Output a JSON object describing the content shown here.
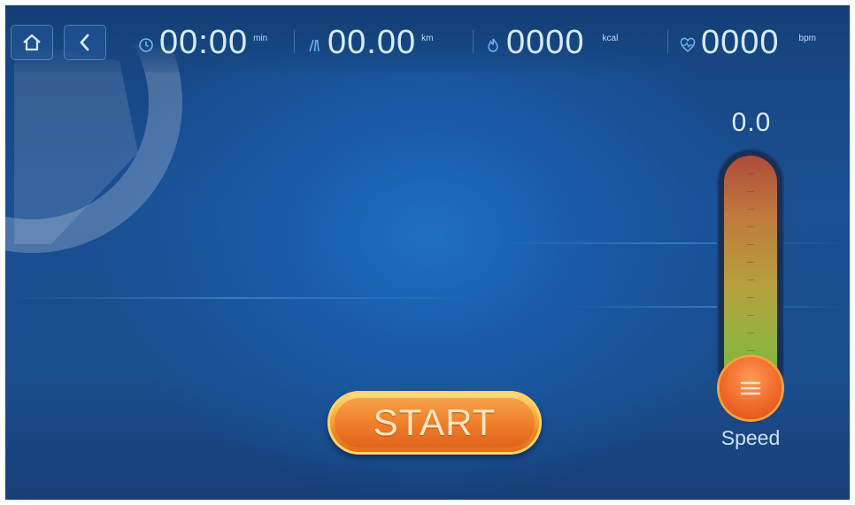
{
  "topbar": {
    "home_icon": "home-icon",
    "back_icon": "chevron-left-icon",
    "stats": [
      {
        "id": "time",
        "icon": "clock-icon",
        "value": "00:00",
        "unit": "min"
      },
      {
        "id": "distance",
        "icon": "road-icon",
        "value": "00.00",
        "unit": "km"
      },
      {
        "id": "calories",
        "icon": "flame-icon",
        "value": "0000",
        "unit": "kcal"
      },
      {
        "id": "heart_rate",
        "icon": "heart-rate-icon",
        "value": "0000",
        "unit": "bpm"
      }
    ]
  },
  "main": {
    "start_label": "START"
  },
  "speed": {
    "value": "0.0",
    "label": "Speed",
    "level_fraction": 0.0
  },
  "colors": {
    "background": "#1a5aa8",
    "accent_orange": "#ee8a20",
    "text_light": "#d6ebfc"
  }
}
